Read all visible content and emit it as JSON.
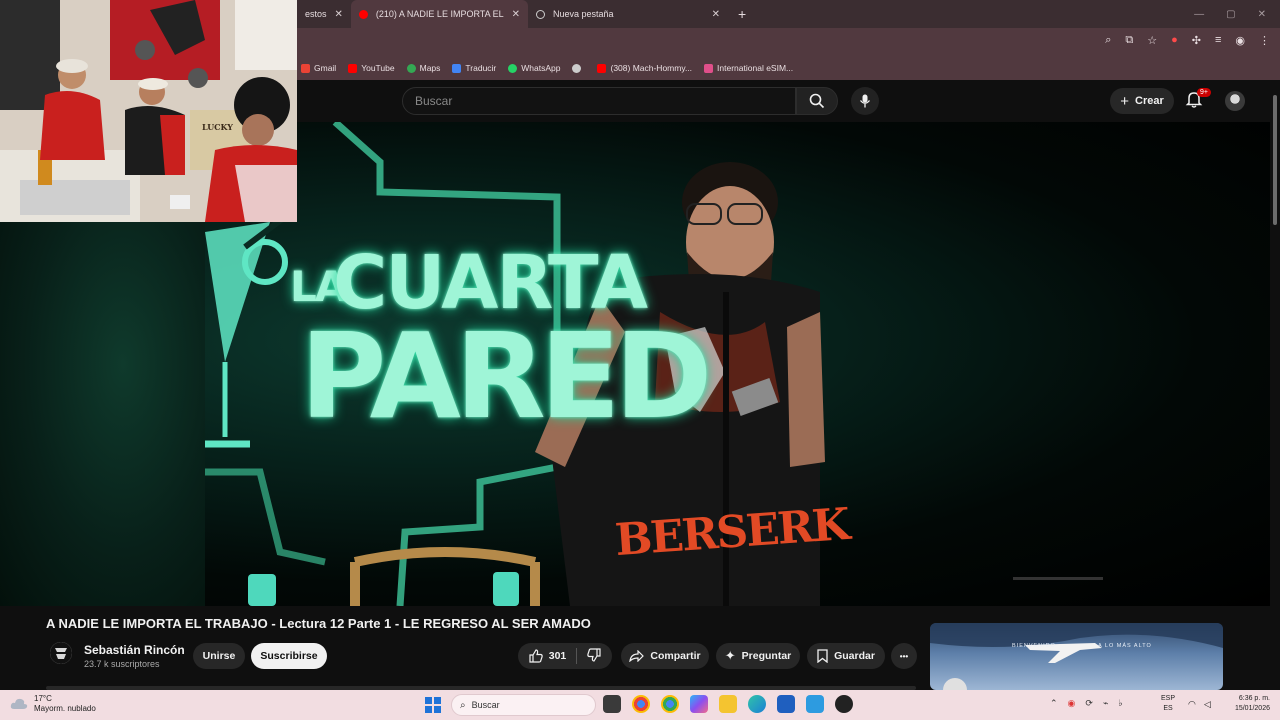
{
  "browser": {
    "tabs": [
      {
        "title": "estos"
      },
      {
        "title": "(210) A NADIE LE IMPORTA EL",
        "active": true
      },
      {
        "title": "Nueva pestaña"
      }
    ],
    "new_tab_label": "+",
    "bookmarks": [
      {
        "label": "Gmail",
        "color": "#ea4335"
      },
      {
        "label": "YouTube",
        "color": "#ff0000"
      },
      {
        "label": "Maps",
        "color": "#34a853"
      },
      {
        "label": "Traducir",
        "color": "#4285f4"
      },
      {
        "label": "WhatsApp",
        "color": "#25d366"
      },
      {
        "label": "",
        "color": "#cccccc"
      },
      {
        "label": "(308) Mach-Hommy...",
        "color": "#ff0000"
      },
      {
        "label": "International eSIM...",
        "color": "#e04f8a"
      }
    ]
  },
  "youtube": {
    "search_placeholder": "Buscar",
    "create_label": "Crear",
    "notifications_badge": "9+"
  },
  "video": {
    "sign_line1": "LA",
    "sign_line2": "CUARTA",
    "sign_line3": "PARED",
    "shirt_text": "BERSERK",
    "title": "A NADIE LE IMPORTA EL TRABAJO - Lectura 12 Parte 1 - LE REGRESO AL SER AMADO",
    "channel_name": "Sebastián Rincón",
    "subscribers": "23.7 k suscriptores",
    "join_label": "Unirse",
    "subscribe_label": "Suscribirse",
    "likes": "301",
    "share_label": "Compartir",
    "ask_label": "Preguntar",
    "save_label": "Guardar",
    "more_label": "•••"
  },
  "pip": {
    "sign_text": "LUCKY"
  },
  "recommendation": {
    "text_left": "BIENVENIDO",
    "text_right": "A LO MÁS ALTO"
  },
  "taskbar": {
    "temperature": "17°C",
    "weather": "Mayorm. nublado",
    "search_placeholder": "Buscar",
    "lang_top": "ESP",
    "lang_bottom": "ES",
    "time": "6:36 p. m.",
    "date": "15/01/2026"
  },
  "colors": {
    "youtube_red": "#ff0000",
    "accent_neon": "#9ff5d7",
    "taskbar_bg": "#f2dde1",
    "chrome_bg": "#51393f"
  }
}
